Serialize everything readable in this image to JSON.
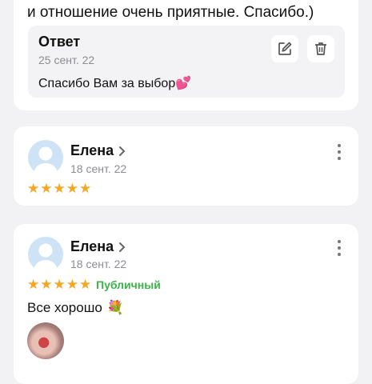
{
  "top_review": {
    "text_tail": "и отношение очень приятные. Спасибо.)",
    "reply": {
      "title": "Ответ",
      "date": "25 сент. 22",
      "text": "Спасибо Вам за выбор",
      "emoji": "💕"
    }
  },
  "reviews": [
    {
      "name": "Елена",
      "date": "18 сент. 22",
      "rating": 5,
      "badge": "",
      "text": ""
    },
    {
      "name": "Елена",
      "date": "18 сент. 22",
      "rating": 5,
      "badge": "Публичный",
      "text": "Все хорошо",
      "emoji": "💐"
    }
  ],
  "colors": {
    "star": "#f5a623",
    "badge": "#3ab44a",
    "avatar": "#cfe3f6"
  }
}
